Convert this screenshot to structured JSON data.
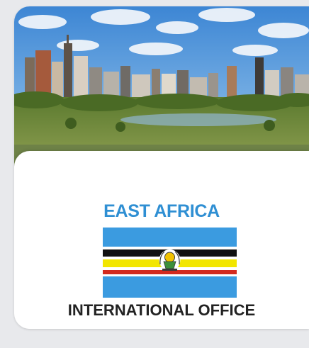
{
  "card": {
    "region_title": "EAST AFRICA",
    "office_title": "INTERNATIONAL OFFICE",
    "hero_image": "nairobi-city-skyline",
    "flag": "east-african-community-flag"
  },
  "colors": {
    "title_blue": "#2f8fd3",
    "flag_blue": "#3b9be0",
    "band_green": "#6e8247",
    "text_dark": "#222222"
  }
}
